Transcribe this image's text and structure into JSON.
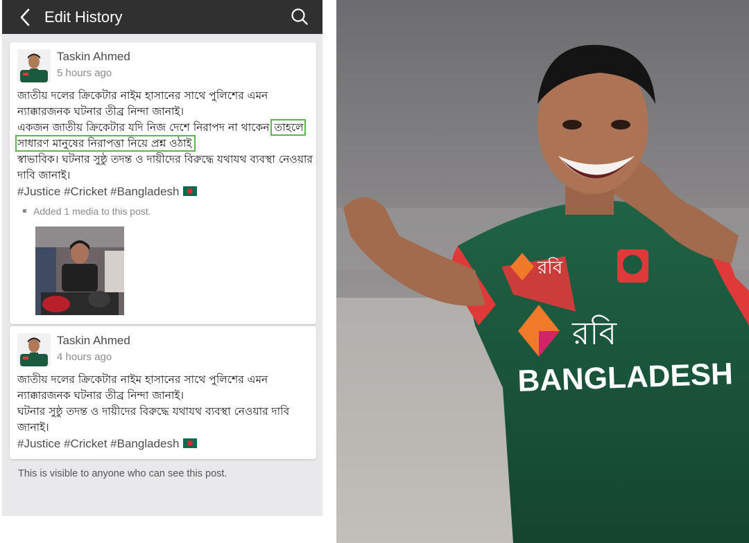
{
  "header": {
    "title": "Edit History",
    "back_icon": "chevron-left-icon",
    "search_icon": "search-icon"
  },
  "revisions": [
    {
      "author": "Taskin Ahmed",
      "time": "5 hours ago",
      "lines": [
        "জাতীয় দলের ক্রিকেটার নাইম হাসানের সাথে পুলিশের এমন ন্যাক্কারজনক ঘটনার তীব্র নিন্দা জানাই।",
        "একজন জাতীয় ক্রিকেটার যদি নিজ দেশে নিরাপদ না থাকেন,",
        "তাহলে সাধারণ মানুষের নিরাপত্তা নিয়ে প্রশ্ন ওঠাই",
        "স্বাভাবিক। ঘটনার সুষ্ঠু তদন্ত ও দায়ীদের বিরুদ্ধে যথাযথ ব্যবস্থা নেওয়ার দাবি জানাই।"
      ],
      "hashtags": "#Justice #Cricket #Bangladesh",
      "media_note": "Added 1 media to this post."
    },
    {
      "author": "Taskin Ahmed",
      "time": "4 hours ago",
      "lines": [
        "জাতীয় দলের ক্রিকেটার নাইম হাসানের সাথে পুলিশের এমন ন্যাক্কারজনক ঘটনার তীব্র নিন্দা জানাই।",
        "ঘটনার সুষ্ঠু তদন্ত ও দায়ীদের বিরুদ্ধে যথাযথ ব্যবস্থা নেওয়ার দাবি জানাই।"
      ],
      "hashtags": "#Justice #Cricket #Bangladesh"
    }
  ],
  "footer_note": "This is visible to anyone who can see this post.",
  "photo": {
    "jersey_brand": "রবি",
    "jersey_text": "BANGLADESH"
  },
  "colors": {
    "topbar": "#303030",
    "highlight": "#5ab54b",
    "jersey_green": "#1c5a40",
    "jersey_red": "#e0393a"
  }
}
